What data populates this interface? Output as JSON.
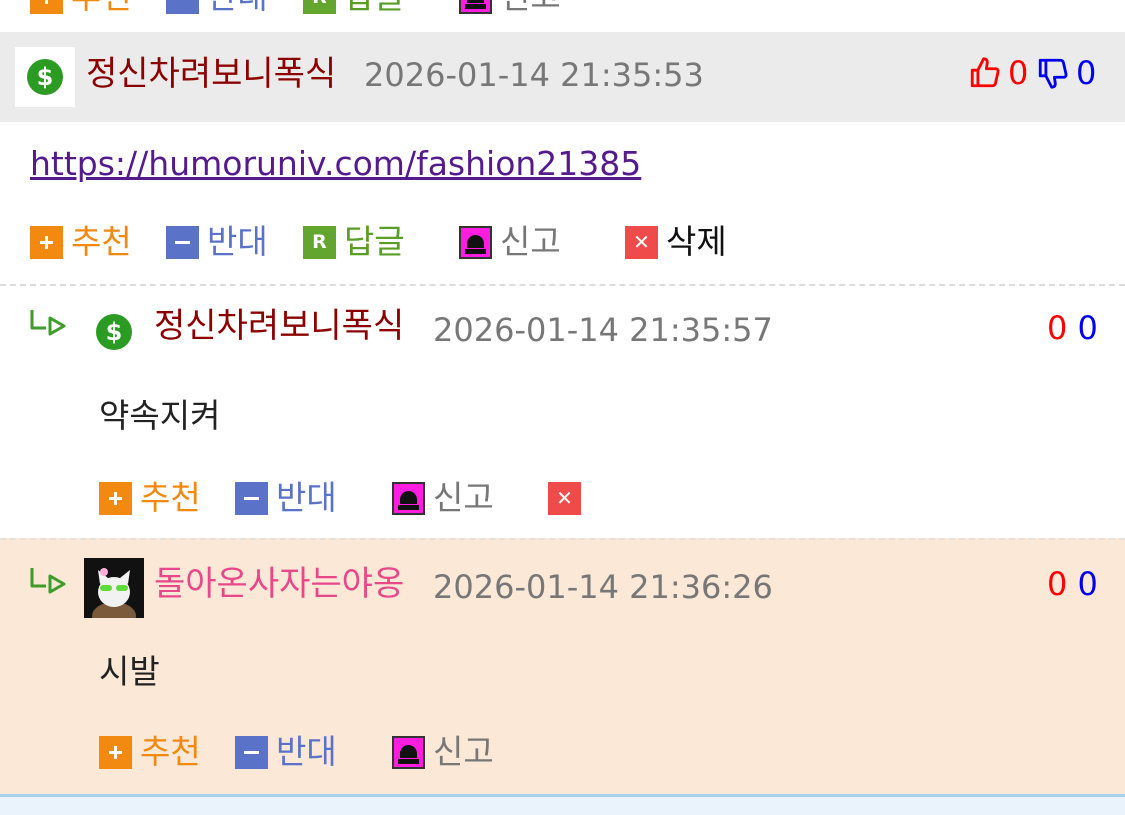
{
  "top_partial": {
    "labels": [
      "추천",
      "반대",
      "답글",
      "신고"
    ]
  },
  "comments": [
    {
      "nickname": "정신차려보니폭식",
      "timestamp": "2026-01-14 21:35:53",
      "link": "https://humoruniv.com/fashion21385",
      "likes": "0",
      "dislikes": "0",
      "actions": {
        "recommend": "추천",
        "oppose": "반대",
        "reply": "답글",
        "report": "신고",
        "delete": "삭제"
      }
    },
    {
      "nickname": "정신차려보니폭식",
      "timestamp": "2026-01-14 21:35:57",
      "text": "약속지켜",
      "likes": "0",
      "dislikes": "0",
      "actions": {
        "recommend": "추천",
        "oppose": "반대",
        "report": "신고"
      }
    },
    {
      "nickname": "돌아온사자는야옹",
      "timestamp": "2026-01-14 21:36:26",
      "text": "시발",
      "likes": "0",
      "dislikes": "0",
      "actions": {
        "recommend": "추천",
        "oppose": "반대",
        "report": "신고"
      }
    }
  ],
  "colors": {
    "header_bg": "#ebebeb",
    "highlight_bg": "#fbe8d6",
    "nickname_red": "#8b0000",
    "nickname_pink": "#e8488a",
    "recommend": "#f28a12",
    "oppose": "#5a72c8",
    "reply": "#5a9e25",
    "like_count": "#ff0000",
    "dislike_count": "#0000ee"
  },
  "icons": [
    "dollar-icon",
    "thumbs-up-icon",
    "thumbs-down-icon",
    "reply-arrow-icon",
    "plus-icon",
    "minus-icon",
    "reply-r-icon",
    "siren-icon",
    "delete-x-icon",
    "avatar-image"
  ]
}
